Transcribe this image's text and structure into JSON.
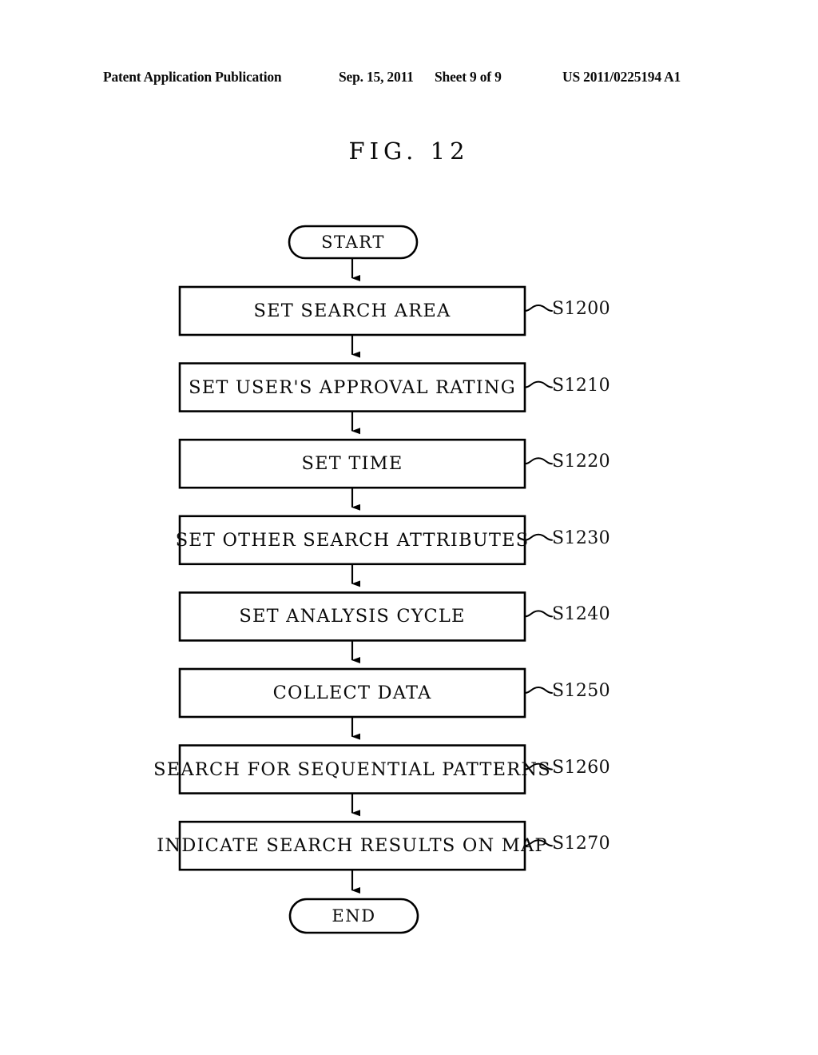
{
  "header": {
    "publication": "Patent Application Publication",
    "date": "Sep. 15, 2011",
    "sheet": "Sheet 9 of 9",
    "document_number": "US 2011/0225194 A1"
  },
  "figure": {
    "title": "FIG. 12",
    "line_color": "#000000",
    "background_color": "#ffffff"
  },
  "flowchart": {
    "start_node": {
      "label": "START",
      "shape": "stadium"
    },
    "end_node": {
      "label": "END",
      "shape": "stadium"
    },
    "steps": [
      {
        "label": "SET SEARCH AREA",
        "ref": "S1200"
      },
      {
        "label": "SET USER'S APPROVAL RATING",
        "ref": "S1210"
      },
      {
        "label": "SET TIME",
        "ref": "S1220"
      },
      {
        "label": "SET OTHER SEARCH ATTRIBUTES",
        "ref": "S1230"
      },
      {
        "label": "SET ANALYSIS CYCLE",
        "ref": "S1240"
      },
      {
        "label": "COLLECT DATA",
        "ref": "S1250"
      },
      {
        "label": "SEARCH FOR SEQUENTIAL PATTERNS",
        "ref": "S1260"
      },
      {
        "label": "INDICATE SEARCH RESULTS ON MAP",
        "ref": "S1270"
      }
    ]
  }
}
